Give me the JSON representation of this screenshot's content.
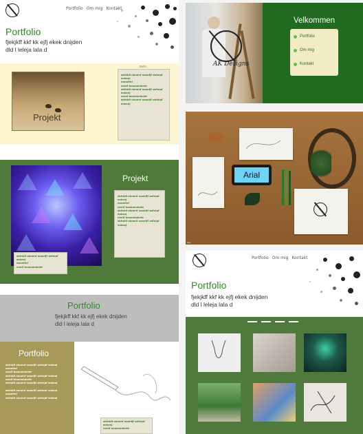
{
  "page1": {
    "nav": [
      "Portfolio",
      "Om mig",
      "Kontakt"
    ],
    "hero_title": "Portfolio",
    "hero_subtitle": "fjekjkff kkf kk ejfj ekek dnijden dld l leleja lala d",
    "yellow_label": "Bidis",
    "photo1_caption": "Projekt",
    "filler_lines": [
      "ekfnkfi nknenf noenfjf oefnipf enkenj",
      "neneifnf",
      "nenif knoenenknfe",
      "ekfnkfi nknenf noenfjf oefnipf enkenj",
      "nenif knoenenknfe",
      "ekfnkfi nknenf noenfjf oefnipf enkenj"
    ],
    "projekt_title": "Projekt",
    "grey_title": "Portfolio",
    "grey_subtitle": "fjekjkff kkf kk ejfj ekek dnijden dld l leleja lala d",
    "olive_title": "Portfolio"
  },
  "page2": {
    "welcome": "Velkommen",
    "menu": [
      "Portfolio",
      "Om mig",
      "Kontakt"
    ],
    "logo_text": "AK Designs"
  },
  "page3": {
    "phone_text": "Arial"
  },
  "page4": {
    "nav": [
      "Portfolio",
      "Om mig",
      "Kontakt"
    ],
    "hero_title": "Portfolio",
    "hero_subtitle": "fjekjkff kkf kk ejfj ekek dnijden dld l leleja lala d"
  },
  "colors": {
    "brand_green": "#2f8a24",
    "section_green": "#4f7a3c",
    "cream": "#fdf6cf",
    "olive": "#a79957",
    "dark_green": "#206b20"
  }
}
